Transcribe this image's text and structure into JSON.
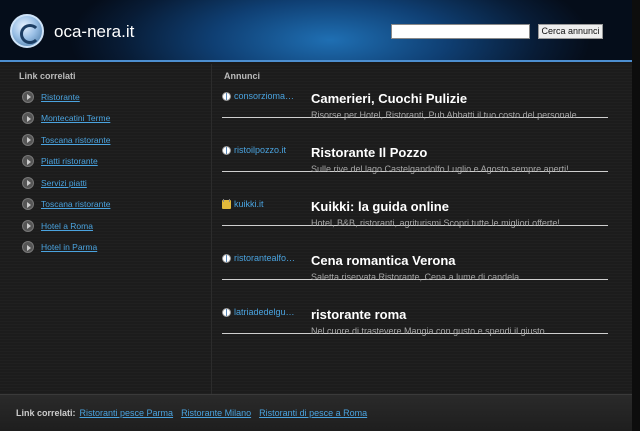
{
  "header": {
    "site_title": "oca-nera.it",
    "search": {
      "value": "",
      "placeholder": "",
      "button_label": "Cerca annunci"
    }
  },
  "sidebar": {
    "title": "Link correlati",
    "items": [
      {
        "label": "Ristorante"
      },
      {
        "label": "Montecatini Terme"
      },
      {
        "label": "Toscana ristorante"
      },
      {
        "label": "Piatti ristorante"
      },
      {
        "label": "Servizi piatti"
      },
      {
        "label": "Toscana ristorante"
      },
      {
        "label": "Hotel a Roma"
      },
      {
        "label": "Hotel in Parma"
      }
    ]
  },
  "content": {
    "title": "Annunci",
    "ads": [
      {
        "domain": "consorzioma…",
        "icon": "globe-icon",
        "title": "Camerieri, Cuochi Pulizie",
        "description": "Risorse per Hotel, Ristoranti, Pub Abbatti il tuo costo del personale"
      },
      {
        "domain": "ristoilpozzo.it",
        "icon": "globe-icon",
        "title": "Ristorante Il Pozzo",
        "description": "Sulle rive del lago Castelgandolfo Luglio e Agosto sempre aperti!"
      },
      {
        "domain": "kuikki.it",
        "icon": "lock-icon",
        "title": "Kuikki: la guida online",
        "description": "Hotel, B&B, ristoranti, agriturismi Scopri tutte le migliori offerte!"
      },
      {
        "domain": "ristorantealfo…",
        "icon": "globe-icon",
        "title": "Cena romantica Verona",
        "description": "Saletta riservata Ristorante, Cena a lume di candela"
      },
      {
        "domain": "latriadedelgu…",
        "icon": "globe-icon",
        "title": "ristorante roma",
        "description": "Nel cuore di trastevere Mangia con gusto e spendi il giusto"
      }
    ]
  },
  "footer": {
    "label": "Link correlati:",
    "links": [
      {
        "label": "Ristoranti pesce Parma"
      },
      {
        "label": "Ristorante Milano"
      },
      {
        "label": "Ristoranti di pesce a Roma"
      }
    ]
  },
  "colors": {
    "accent": "#4aa3df",
    "header_blue": "#1f6fb3",
    "background": "#1c1c1c"
  }
}
